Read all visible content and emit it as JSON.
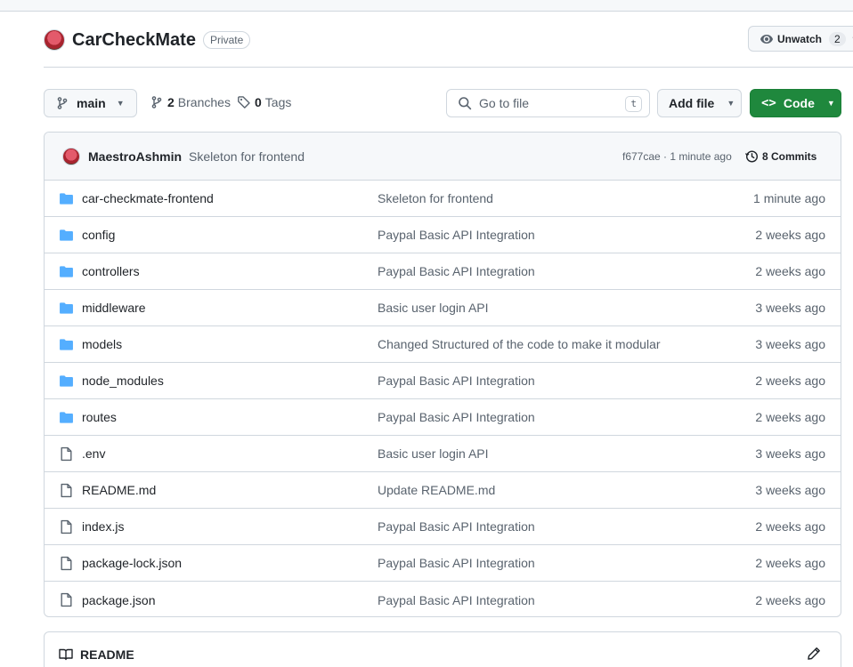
{
  "repo": {
    "name": "CarCheckMate",
    "visibility": "Private"
  },
  "watch": {
    "label": "Unwatch",
    "count": "2"
  },
  "toolbar": {
    "branch": "main",
    "branches_count": "2",
    "branches_label": "Branches",
    "tags_count": "0",
    "tags_label": "Tags",
    "search_placeholder": "Go to file",
    "search_shortcut": "t",
    "add_file_label": "Add file",
    "code_label": "Code"
  },
  "latest_commit": {
    "author": "MaestroAshmin",
    "message": "Skeleton for frontend",
    "meta": "f677cae · 1 minute ago",
    "commits_label": "8 Commits"
  },
  "files": [
    {
      "type": "folder",
      "name": "car-checkmate-frontend",
      "message": "Skeleton for frontend",
      "date": "1 minute ago"
    },
    {
      "type": "folder",
      "name": "config",
      "message": "Paypal Basic API Integration",
      "date": "2 weeks ago"
    },
    {
      "type": "folder",
      "name": "controllers",
      "message": "Paypal Basic API Integration",
      "date": "2 weeks ago"
    },
    {
      "type": "folder",
      "name": "middleware",
      "message": "Basic user login API",
      "date": "3 weeks ago"
    },
    {
      "type": "folder",
      "name": "models",
      "message": "Changed Structured of the code to make it modular",
      "date": "3 weeks ago"
    },
    {
      "type": "folder",
      "name": "node_modules",
      "message": "Paypal Basic API Integration",
      "date": "2 weeks ago"
    },
    {
      "type": "folder",
      "name": "routes",
      "message": "Paypal Basic API Integration",
      "date": "2 weeks ago"
    },
    {
      "type": "file",
      "name": ".env",
      "message": "Basic user login API",
      "date": "3 weeks ago"
    },
    {
      "type": "file",
      "name": "README.md",
      "message": "Update README.md",
      "date": "3 weeks ago"
    },
    {
      "type": "file",
      "name": "index.js",
      "message": "Paypal Basic API Integration",
      "date": "2 weeks ago"
    },
    {
      "type": "file",
      "name": "package-lock.json",
      "message": "Paypal Basic API Integration",
      "date": "2 weeks ago"
    },
    {
      "type": "file",
      "name": "package.json",
      "message": "Paypal Basic API Integration",
      "date": "2 weeks ago"
    }
  ],
  "readme": {
    "label": "README"
  },
  "colors": {
    "folder": "#54aeff",
    "file": "#59636e",
    "primary_button": "#1f883d",
    "border": "#d0d7de"
  }
}
